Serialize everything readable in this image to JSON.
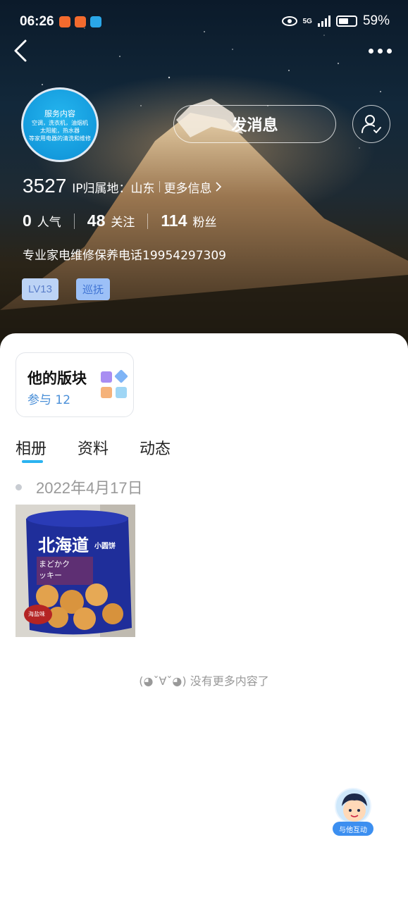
{
  "status_bar": {
    "time": "06:26",
    "network": "5G",
    "battery_text": "59%",
    "battery_level": 0.59
  },
  "avatar": {
    "title": "服务内容",
    "lines": [
      "空调，洗衣机，油烟机",
      "太阳能，热水器",
      "等家用电器的清洗和维修"
    ]
  },
  "header": {
    "message_label": "发消息",
    "user_id": "3527",
    "ip_label": "IP归属地：山东",
    "more_info_label": "更多信息",
    "stats": [
      {
        "value": "0",
        "label": "人气"
      },
      {
        "value": "48",
        "label": "关注"
      },
      {
        "value": "114",
        "label": "粉丝"
      }
    ],
    "bio": "专业家电维修保养电话19954297309",
    "badges": [
      "LV13",
      "巡抚"
    ]
  },
  "board": {
    "title": "他的版块",
    "subtitle": "参与 12"
  },
  "tabs": [
    {
      "label": "相册",
      "active": true
    },
    {
      "label": "资料",
      "active": false
    },
    {
      "label": "动态",
      "active": false
    }
  ],
  "album": {
    "date": "2022年4月17日",
    "photo": {
      "brand": "北海道",
      "side_text": "小圆饼",
      "jp_line1": "まどかク",
      "jp_line2": "ッキー",
      "flavor": "海盐味"
    }
  },
  "end_message": "(◕ˇ∀ˇ◕) 没有更多内容了",
  "interact": {
    "label": "与他互动"
  },
  "colors": {
    "accent": "#2bb3f0",
    "link_blue": "#4a8fd8",
    "badge_lv_bg": "#bcd3f5",
    "badge_patrol_bg": "#9cc0f7"
  }
}
